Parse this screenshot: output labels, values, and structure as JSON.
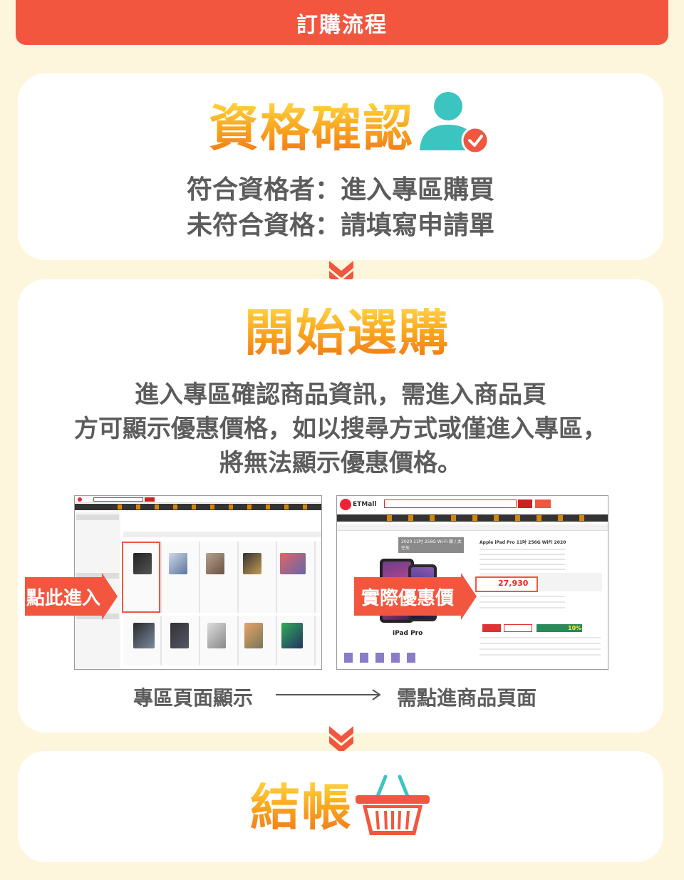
{
  "header": {
    "title": "訂購流程"
  },
  "step1": {
    "title": "資格確認",
    "line1": "符合資格者：進入專區購買",
    "line2": "未符合資格：請填寫申請單",
    "icon": "user-check-icon"
  },
  "step2": {
    "title": "開始選購",
    "line1": "進入專區確認商品資訊，需進入商品頁",
    "line2": "方可顯示優惠價格，如以搜尋方式或僅進入專區，",
    "line3": "將無法顯示優惠價格。",
    "callout_left": "點此進入",
    "callout_right": "實際優惠價",
    "caption_left": "專區頁面顯示",
    "caption_right": "需點進商品頁面",
    "right_shot": {
      "logo": "ETMall",
      "banner": "2020 11吋 256G Wi-Fi 銀 / 太空灰",
      "product": "Apple iPad Pro 11吋 256G WiFi 2020",
      "price": "27,930",
      "caption": "iPad Pro",
      "badge": "10%"
    }
  },
  "step3": {
    "title": "結帳",
    "icon": "shopping-basket-icon"
  },
  "colors": {
    "accent": "#f2563f",
    "title_gradient_top": "#ffd23e",
    "title_gradient_bottom": "#f27b1a",
    "teal": "#3cc4c0",
    "background": "#fdf6dc",
    "text_gray": "#5c5c5c"
  }
}
